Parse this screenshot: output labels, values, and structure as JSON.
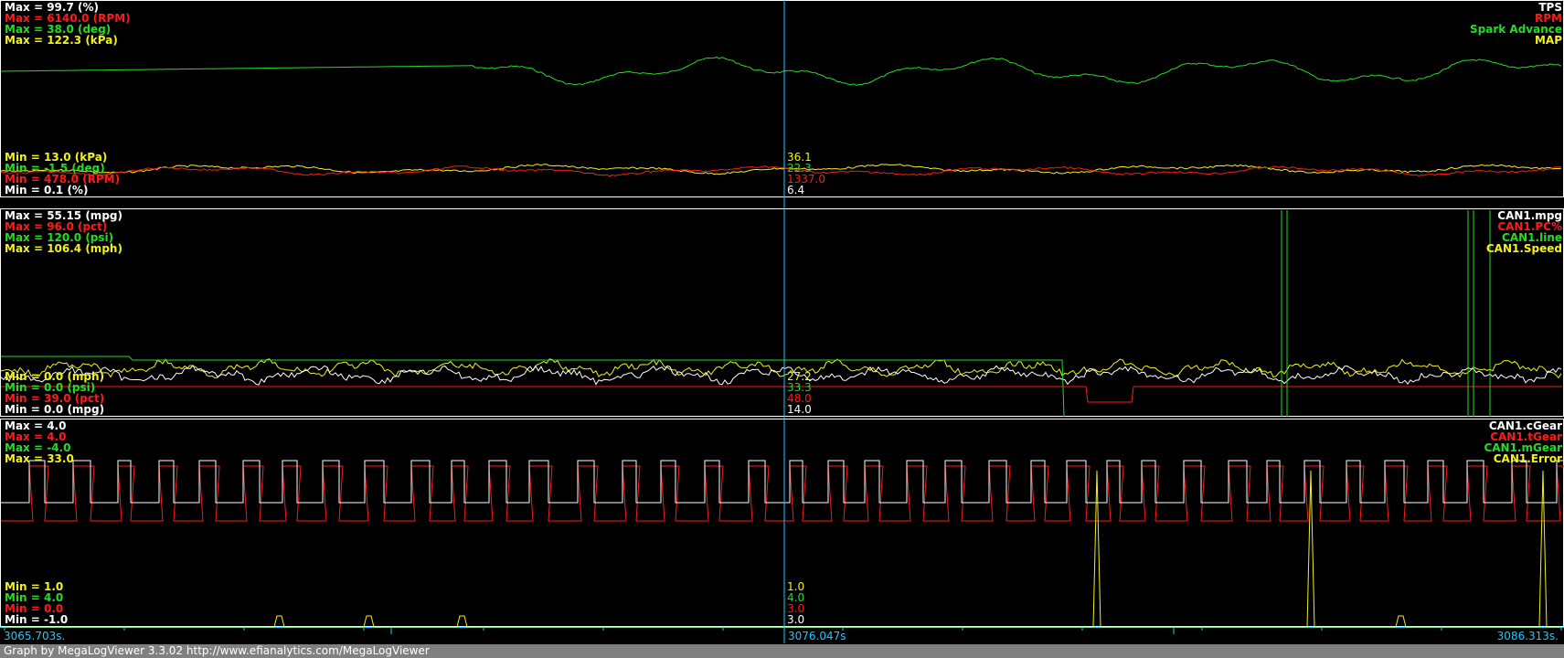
{
  "colors": {
    "white": "#ffffff",
    "red": "#ff1a1a",
    "green": "#22dd22",
    "yellow": "#f2f21a",
    "cursor": "#1ec8ff",
    "border": "#ffffff",
    "background": "#000000"
  },
  "panels": [
    {
      "max_labels": [
        {
          "text": "Max = 99.7 (%)",
          "color": "white"
        },
        {
          "text": "Max = 6140.0 (RPM)",
          "color": "red"
        },
        {
          "text": "Max = 38.0 (deg)",
          "color": "green"
        },
        {
          "text": "Max = 122.3 (kPa)",
          "color": "yellow"
        }
      ],
      "min_labels": [
        {
          "text": "Min = 13.0 (kPa)",
          "color": "yellow"
        },
        {
          "text": "Min = -1.5 (deg)",
          "color": "green"
        },
        {
          "text": "Min = 478.0 (RPM)",
          "color": "red"
        },
        {
          "text": "Min = 0.1 (%)",
          "color": "white"
        }
      ],
      "channel_names": [
        {
          "text": "TPS",
          "color": "white"
        },
        {
          "text": "RPM",
          "color": "red"
        },
        {
          "text": "Spark Advance",
          "color": "green"
        },
        {
          "text": "MAP",
          "color": "yellow"
        }
      ],
      "cursor_values": [
        {
          "text": "36.1",
          "color": "yellow"
        },
        {
          "text": "22.3",
          "color": "green"
        },
        {
          "text": "1337.0",
          "color": "red"
        },
        {
          "text": "6.4",
          "color": "white"
        }
      ]
    },
    {
      "max_labels": [
        {
          "text": "Max = 55.15 (mpg)",
          "color": "white"
        },
        {
          "text": "Max = 96.0 (pct)",
          "color": "red"
        },
        {
          "text": "Max = 120.0 (psi)",
          "color": "green"
        },
        {
          "text": "Max = 106.4 (mph)",
          "color": "yellow"
        }
      ],
      "min_labels": [
        {
          "text": "Min = 0.0 (mph)",
          "color": "yellow"
        },
        {
          "text": "Min = 0.0 (psi)",
          "color": "green"
        },
        {
          "text": "Min = 39.0 (pct)",
          "color": "red"
        },
        {
          "text": "Min = 0.0 (mpg)",
          "color": "white"
        }
      ],
      "channel_names": [
        {
          "text": "CAN1.mpg",
          "color": "white"
        },
        {
          "text": "CAN1.PC%",
          "color": "red"
        },
        {
          "text": "CAN1.line",
          "color": "green"
        },
        {
          "text": "CAN1.Speed",
          "color": "yellow"
        }
      ],
      "cursor_values": [
        {
          "text": "27.2",
          "color": "yellow"
        },
        {
          "text": "33.3",
          "color": "green"
        },
        {
          "text": "48.0",
          "color": "red"
        },
        {
          "text": "14.0",
          "color": "white"
        }
      ]
    },
    {
      "max_labels": [
        {
          "text": "Max = 4.0",
          "color": "white"
        },
        {
          "text": "Max = 4.0",
          "color": "red"
        },
        {
          "text": "Max = -4.0",
          "color": "green"
        },
        {
          "text": "Max = 33.0",
          "color": "yellow"
        }
      ],
      "min_labels": [
        {
          "text": "Min = 1.0",
          "color": "yellow"
        },
        {
          "text": "Min = 4.0",
          "color": "green"
        },
        {
          "text": "Min = 0.0",
          "color": "red"
        },
        {
          "text": "Min = -1.0",
          "color": "white"
        }
      ],
      "channel_names": [
        {
          "text": "CAN1.cGear",
          "color": "white"
        },
        {
          "text": "CAN1.tGear",
          "color": "red"
        },
        {
          "text": "CAN1.mGear",
          "color": "green"
        },
        {
          "text": "CAN1.Error",
          "color": "yellow"
        }
      ],
      "cursor_values": [
        {
          "text": "1.0",
          "color": "yellow"
        },
        {
          "text": "4.0",
          "color": "green"
        },
        {
          "text": "3.0",
          "color": "red"
        },
        {
          "text": "3.0",
          "color": "white"
        }
      ]
    }
  ],
  "time_axis": {
    "start": "3065.703s.",
    "cursor": "3076.047s",
    "end": "3086.313s.",
    "start_seconds": 3065.703,
    "cursor_seconds": 3076.047,
    "end_seconds": 3086.313
  },
  "footer": "Graph by MegaLogViewer 3.3.02 http://www.efianalytics.com/MegaLogViewer"
}
